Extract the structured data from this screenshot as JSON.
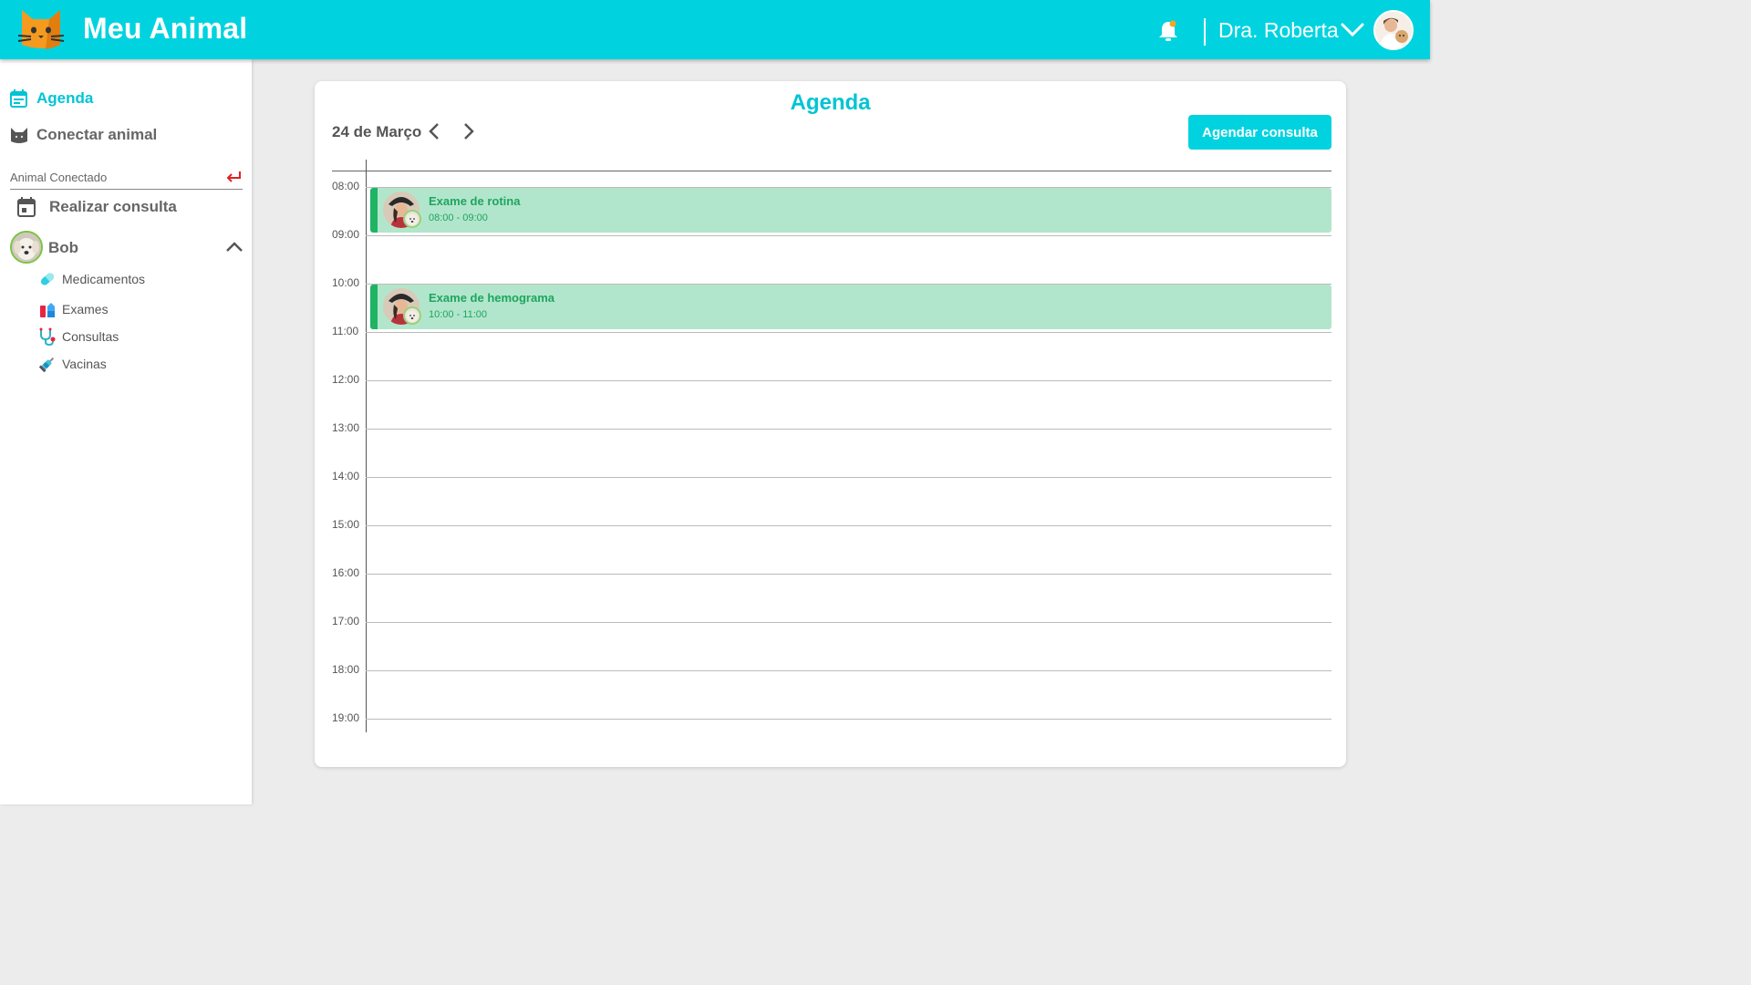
{
  "header": {
    "app_title": "Meu Animal",
    "user_name": "Dra. Roberta",
    "brand_color": "#00d3df",
    "icons": [
      "cat-logo-icon",
      "bell-icon",
      "chevron-down-icon",
      "user-avatar"
    ]
  },
  "sidebar": {
    "agenda_label": "Agenda",
    "connect_label": "Conectar animal",
    "connected_label": "Animal Conectado",
    "consult_label": "Realizar consulta",
    "pet_name": "Bob",
    "sub_items": [
      {
        "label": "Medicamentos",
        "icon": "pill-icon"
      },
      {
        "label": "Exames",
        "icon": "test-tubes-icon"
      },
      {
        "label": "Consultas",
        "icon": "stethoscope-icon"
      },
      {
        "label": "Vacinas",
        "icon": "syringe-icon"
      }
    ]
  },
  "agenda": {
    "title": "Agenda",
    "date": "24 de Março",
    "schedule_button": "Agendar consulta",
    "hours": [
      "08:00",
      "09:00",
      "10:00",
      "11:00",
      "12:00",
      "13:00",
      "14:00",
      "15:00",
      "16:00",
      "17:00",
      "18:00",
      "19:00"
    ],
    "events": [
      {
        "title": "Exame de rotina",
        "time": "08:00 - 09:00"
      },
      {
        "title": "Exame de hemograma",
        "time": "10:00 - 11:00"
      }
    ],
    "event_color": "#b2e6cc",
    "event_accent": "#1fb364"
  }
}
